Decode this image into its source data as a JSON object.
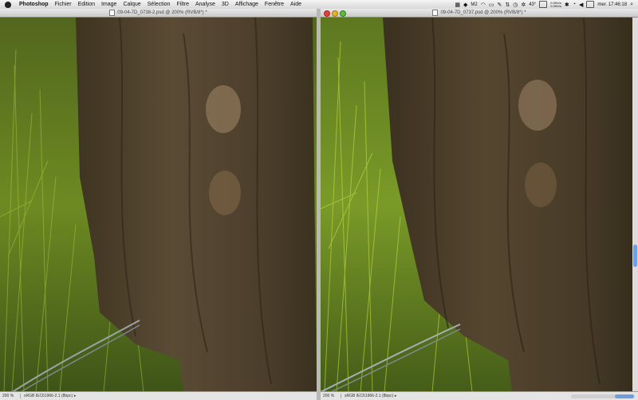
{
  "menubar": {
    "app_name": "Photoshop",
    "items": [
      "Fichier",
      "Edition",
      "Image",
      "Calque",
      "Sélection",
      "Filtre",
      "Analyse",
      "3D",
      "Affichage",
      "Fenêtre",
      "Aide"
    ],
    "tray": {
      "m2_label": "M2",
      "temperature": "43°",
      "net_up": "0.0Kb/s",
      "net_down": "0.0Kb/s",
      "clock": "mer. 17:46:18"
    }
  },
  "windows": {
    "left": {
      "title": "09-04-7D_0738-2.psd @ 200% (RVB/8*) *",
      "zoom": "200 %",
      "profile": "sRGB IEC61966-2.1 (8bpc)"
    },
    "right": {
      "title": "09-04-7D_0737.psd @ 200% (RVB/8*) *",
      "zoom": "200 %",
      "profile": "sRGB IEC61966-2.1 (8bpc)"
    }
  },
  "colors": {
    "accent_scroll": "#6f9fdb",
    "close": "#e0443e",
    "minimize": "#e6b12a",
    "zoom": "#5fbf3b"
  }
}
